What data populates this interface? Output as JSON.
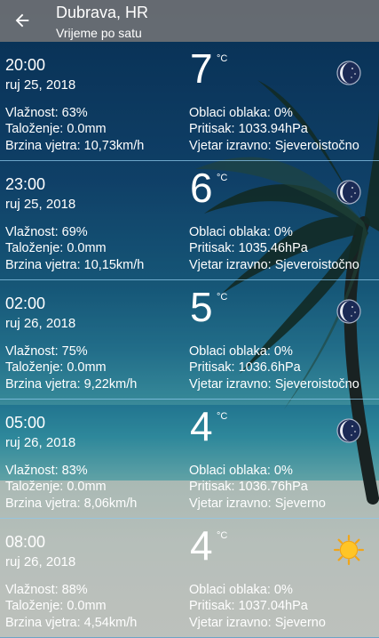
{
  "header": {
    "title": "Dubrava, HR",
    "subtitle": "Vrijeme po satu",
    "back_icon": "arrow-left-icon"
  },
  "unit": "°C",
  "rows": [
    {
      "time": "20:00",
      "date": "ruj 25, 2018",
      "temp": "7",
      "humidity": "Vlažnost: 63%",
      "precip": "Taloženje: 0.0mm",
      "wind": "Brzina vjetra: 10,73km/h",
      "clouds": "Oblaci oblaka: 0%",
      "pressure": "Pritisak: 1033.94hPa",
      "direction": "Vjetar izravno: Sjeveroistočno",
      "icon": "moon-icon"
    },
    {
      "time": "23:00",
      "date": "ruj 25, 2018",
      "temp": "6",
      "humidity": "Vlažnost: 69%",
      "precip": "Taloženje: 0.0mm",
      "wind": "Brzina vjetra: 10,15km/h",
      "clouds": "Oblaci oblaka: 0%",
      "pressure": "Pritisak: 1035.46hPa",
      "direction": "Vjetar izravno: Sjeveroistočno",
      "icon": "moon-icon"
    },
    {
      "time": "02:00",
      "date": "ruj 26, 2018",
      "temp": "5",
      "humidity": "Vlažnost: 75%",
      "precip": "Taloženje: 0.0mm",
      "wind": "Brzina vjetra: 9,22km/h",
      "clouds": "Oblaci oblaka: 0%",
      "pressure": "Pritisak: 1036.6hPa",
      "direction": "Vjetar izravno: Sjeveroistočno",
      "icon": "moon-icon"
    },
    {
      "time": "05:00",
      "date": "ruj 26, 2018",
      "temp": "4",
      "humidity": "Vlažnost: 83%",
      "precip": "Taloženje: 0.0mm",
      "wind": "Brzina vjetra: 8,06km/h",
      "clouds": "Oblaci oblaka: 0%",
      "pressure": "Pritisak: 1036.76hPa",
      "direction": "Vjetar izravno: Sjeverno",
      "icon": "moon-icon"
    },
    {
      "time": "08:00",
      "date": "ruj 26, 2018",
      "temp": "4",
      "humidity": "Vlažnost: 88%",
      "precip": "Taloženje: 0.0mm",
      "wind": "Brzina vjetra: 4,54km/h",
      "clouds": "Oblaci oblaka: 0%",
      "pressure": "Pritisak: 1037.04hPa",
      "direction": "Vjetar izravno: Sjeverno",
      "icon": "sun-icon"
    }
  ]
}
